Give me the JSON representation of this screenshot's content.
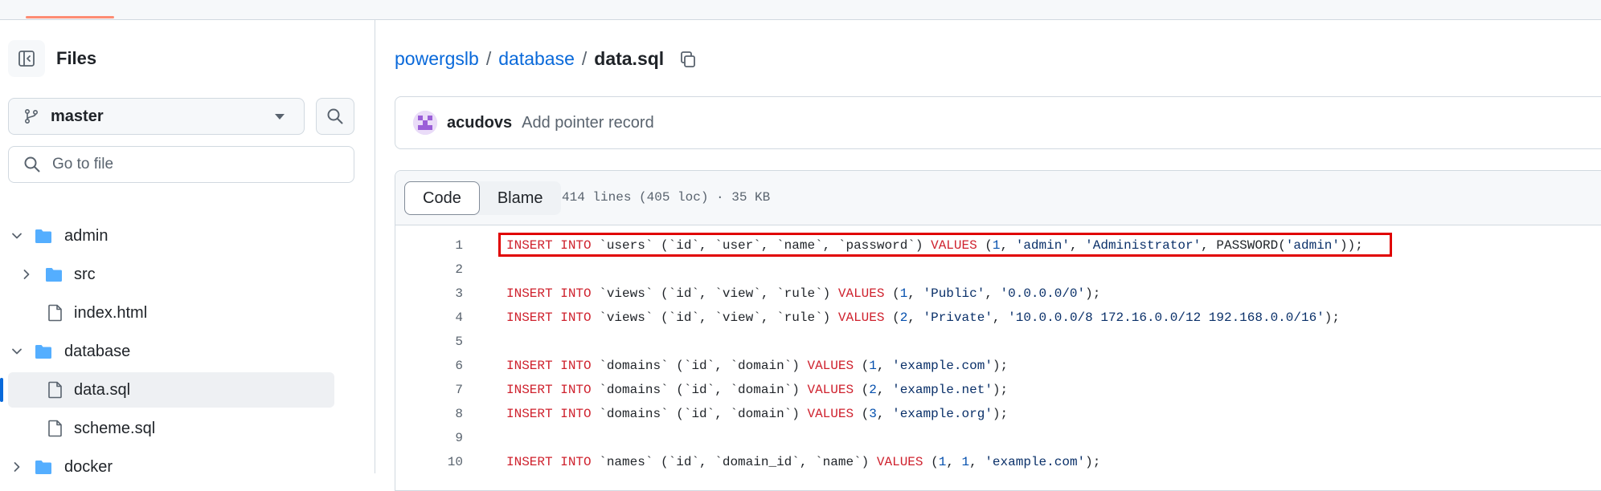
{
  "sidebar": {
    "title": "Files",
    "branch": "master",
    "goto_placeholder": "Go to file",
    "tree": [
      {
        "label": "admin",
        "type": "folder",
        "expanded": true,
        "depth": 0
      },
      {
        "label": "src",
        "type": "folder",
        "expanded": false,
        "depth": 1
      },
      {
        "label": "index.html",
        "type": "file",
        "depth": 1
      },
      {
        "label": "database",
        "type": "folder",
        "expanded": true,
        "depth": 0
      },
      {
        "label": "data.sql",
        "type": "file",
        "depth": 1,
        "selected": true
      },
      {
        "label": "scheme.sql",
        "type": "file",
        "depth": 1
      },
      {
        "label": "docker",
        "type": "folder",
        "expanded": false,
        "depth": 0
      }
    ]
  },
  "breadcrumb": {
    "repo": "powergslb",
    "sep": "/",
    "folder": "database",
    "file": "data.sql"
  },
  "commit": {
    "author": "acudovs",
    "message": "Add pointer record"
  },
  "code_view": {
    "tabs": [
      "Code",
      "Blame"
    ],
    "active_tab": "Code",
    "meta": "414 lines (405 loc) · 35 KB",
    "lines": [
      {
        "n": "1",
        "text": "INSERT INTO `users` (`id`, `user`, `name`, `password`) VALUES (1, 'admin', 'Administrator', PASSWORD('admin'));"
      },
      {
        "n": "2",
        "text": ""
      },
      {
        "n": "3",
        "text": "INSERT INTO `views` (`id`, `view`, `rule`) VALUES (1, 'Public', '0.0.0.0/0');"
      },
      {
        "n": "4",
        "text": "INSERT INTO `views` (`id`, `view`, `rule`) VALUES (2, 'Private', '10.0.0.0/8 172.16.0.0/12 192.168.0.0/16');"
      },
      {
        "n": "5",
        "text": ""
      },
      {
        "n": "6",
        "text": "INSERT INTO `domains` (`id`, `domain`) VALUES (1, 'example.com');"
      },
      {
        "n": "7",
        "text": "INSERT INTO `domains` (`id`, `domain`) VALUES (2, 'example.net');"
      },
      {
        "n": "8",
        "text": "INSERT INTO `domains` (`id`, `domain`) VALUES (3, 'example.org');"
      },
      {
        "n": "9",
        "text": ""
      },
      {
        "n": "10",
        "text": "INSERT INTO `names` (`id`, `domain_id`, `name`) VALUES (1, 1, 'example.com');"
      }
    ],
    "highlighted_line": "1"
  },
  "colors": {
    "accent": "#0969da",
    "keyword": "#cf222e",
    "string": "#0a3069",
    "number": "#0550ae",
    "highlight_box": "#e00000",
    "folder": "#54aeff"
  },
  "icons": {
    "panel_toggle": "sidebar-collapse-icon",
    "branch": "git-branch-icon",
    "search": "search-icon",
    "copy": "copy-icon",
    "folder": "folder-icon",
    "file": "file-icon",
    "chevron_down": "chevron-down-icon",
    "chevron_right": "chevron-right-icon"
  }
}
